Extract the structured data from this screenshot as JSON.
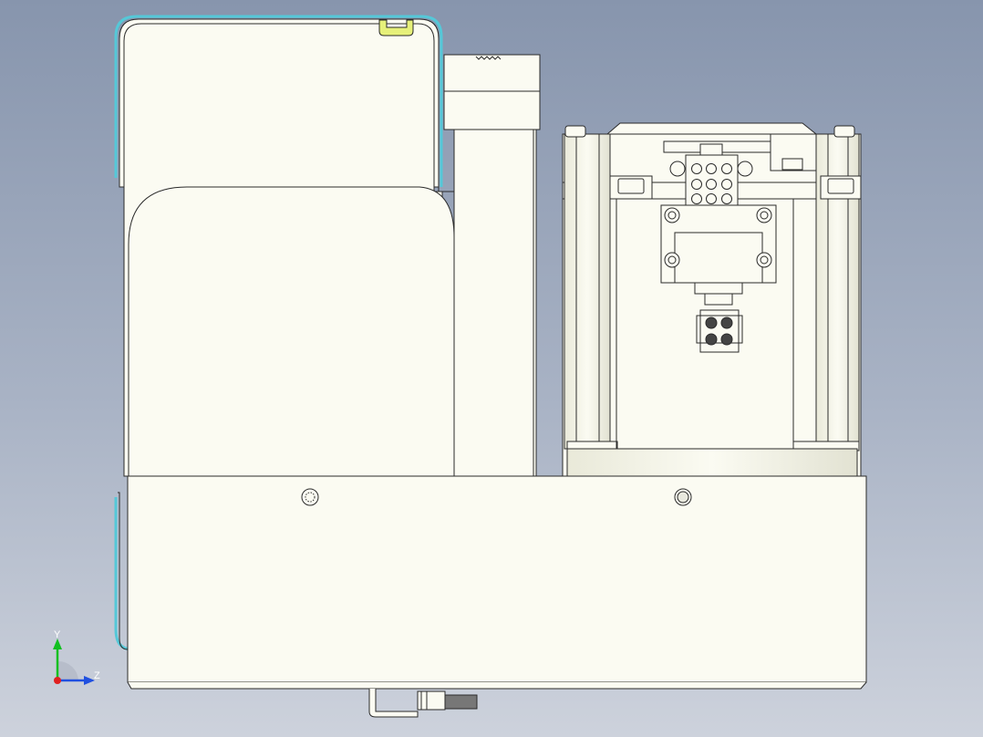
{
  "view": {
    "background_top": "#8795ad",
    "background_bottom": "#cdd2dc",
    "part_fill": "#fbfbf2",
    "edge_color": "#2b2b2b",
    "highlight_color": "#e6f07a",
    "edge_highlight": "#55c8d8"
  },
  "triad": {
    "x_axis_color": "#e02020",
    "y_label": "Y",
    "y_axis_color": "#10c020",
    "z_label": "Z",
    "z_axis_color": "#2050e0",
    "icon": "coordinate-triad-icon"
  }
}
